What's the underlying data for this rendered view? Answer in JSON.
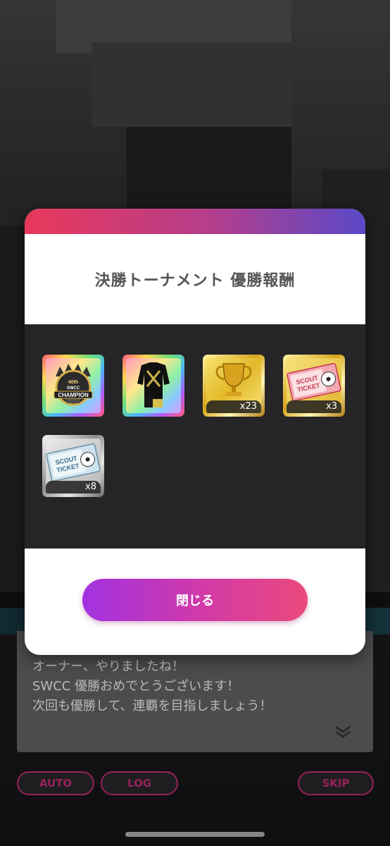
{
  "modal": {
    "title": "決勝トーナメント 優勝報酬",
    "close_label": "閉じる",
    "rewards": [
      {
        "id": "swcc-champion-badge",
        "frame": "rainbow",
        "emblem_text_1": "40th",
        "emblem_text_2": "SWCC",
        "emblem_text_3": "CHAMPION",
        "quantity": ""
      },
      {
        "id": "black-uniform",
        "frame": "rainbow",
        "quantity": ""
      },
      {
        "id": "gold-trophy",
        "frame": "gold",
        "quantity": "x23"
      },
      {
        "id": "red-scout-ticket",
        "frame": "gold",
        "ticket_text_1": "SCOUT",
        "ticket_text_2": "TICKET",
        "quantity": "x3"
      },
      {
        "id": "silver-scout-ticket",
        "frame": "silver",
        "ticket_text_1": "SCOUT",
        "ticket_text_2": "TICKET",
        "quantity": "x8"
      }
    ]
  },
  "dialogue": {
    "line1": "オーナー、やりましたね！",
    "line2": "SWCC 優勝おめでとうございます！",
    "line3": "次回も優勝して、連覇を目指しましょう！",
    "next_icon": "double-chevron-down-icon"
  },
  "controls": {
    "auto_label": "AUTO",
    "log_label": "LOG",
    "skip_label": "SKIP"
  },
  "colors": {
    "accent_pink": "#d0307c",
    "button_gradient_start": "#a232e0",
    "button_gradient_end": "#ea4a7c",
    "header_gradient_start": "#e8385a",
    "header_gradient_end": "#5a49c8"
  }
}
